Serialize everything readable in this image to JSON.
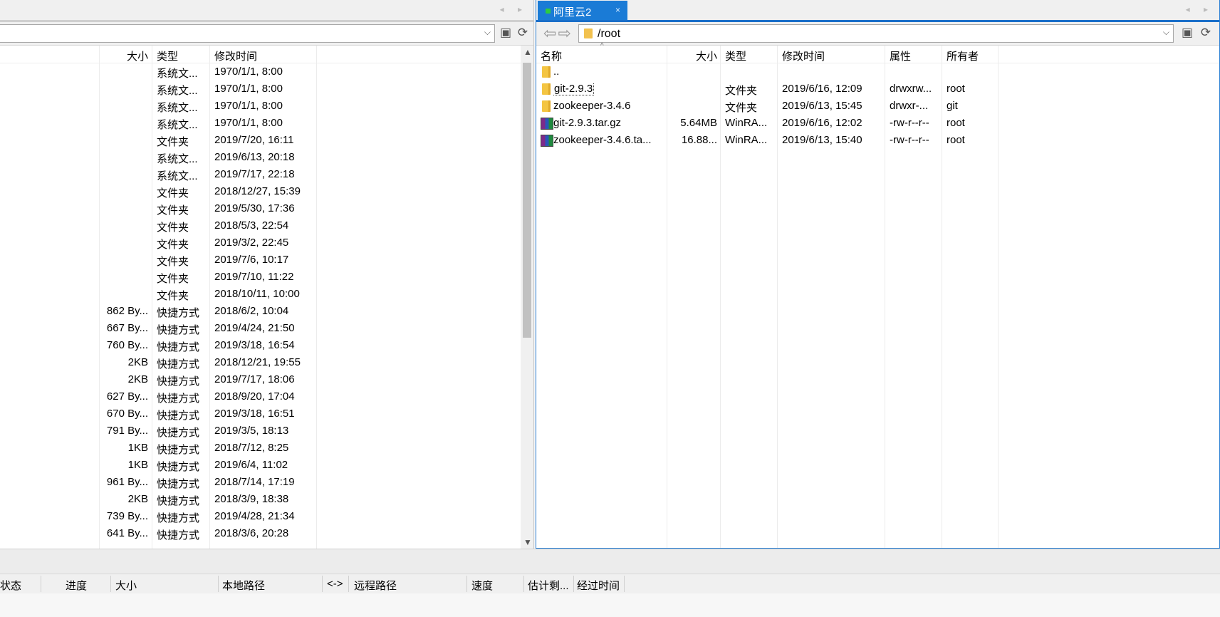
{
  "left": {
    "columns": {
      "size": "大小",
      "type": "类型",
      "mtime": "修改时间"
    },
    "rows": [
      {
        "size": "",
        "type": "系统文...",
        "mtime": "1970/1/1, 8:00"
      },
      {
        "size": "",
        "type": "系统文...",
        "mtime": "1970/1/1, 8:00"
      },
      {
        "size": "",
        "type": "系统文...",
        "mtime": "1970/1/1, 8:00"
      },
      {
        "size": "",
        "type": "系统文...",
        "mtime": "1970/1/1, 8:00"
      },
      {
        "size": "",
        "type": "文件夹",
        "mtime": "2019/7/20, 16:11"
      },
      {
        "size": "",
        "type": "系统文...",
        "mtime": "2019/6/13, 20:18"
      },
      {
        "size": "",
        "type": "系统文...",
        "mtime": "2019/7/17, 22:18"
      },
      {
        "size": "",
        "type": "文件夹",
        "mtime": "2018/12/27, 15:39"
      },
      {
        "size": "",
        "type": "文件夹",
        "mtime": "2019/5/30, 17:36"
      },
      {
        "size": "",
        "type": "文件夹",
        "mtime": "2018/5/3, 22:54"
      },
      {
        "size": "",
        "type": "文件夹",
        "mtime": "2019/3/2, 22:45"
      },
      {
        "size": "",
        "type": "文件夹",
        "mtime": "2019/7/6, 10:17"
      },
      {
        "size": "",
        "type": "文件夹",
        "mtime": "2019/7/10, 11:22"
      },
      {
        "size": "",
        "type": "文件夹",
        "mtime": "2018/10/11, 10:00"
      },
      {
        "size": "862 By...",
        "type": "快捷方式",
        "mtime": "2018/6/2, 10:04"
      },
      {
        "size": "667 By...",
        "type": "快捷方式",
        "mtime": "2019/4/24, 21:50"
      },
      {
        "size": "760 By...",
        "type": "快捷方式",
        "mtime": "2019/3/18, 16:54"
      },
      {
        "size": "2KB",
        "type": "快捷方式",
        "mtime": "2018/12/21, 19:55"
      },
      {
        "size": "2KB",
        "type": "快捷方式",
        "mtime": "2019/7/17, 18:06"
      },
      {
        "size": "627 By...",
        "type": "快捷方式",
        "mtime": "2018/9/20, 17:04"
      },
      {
        "size": "670 By...",
        "type": "快捷方式",
        "mtime": "2019/3/18, 16:51"
      },
      {
        "size": "791 By...",
        "type": "快捷方式",
        "mtime": "2019/3/5, 18:13"
      },
      {
        "size": "1KB",
        "type": "快捷方式",
        "mtime": "2018/7/12, 8:25"
      },
      {
        "size": "1KB",
        "type": "快捷方式",
        "mtime": "2019/6/4, 11:02"
      },
      {
        "size": "961 By...",
        "type": "快捷方式",
        "mtime": "2018/7/14, 17:19"
      },
      {
        "size": "2KB",
        "type": "快捷方式",
        "mtime": "2018/3/9, 18:38"
      },
      {
        "size": "739 By...",
        "type": "快捷方式",
        "mtime": "2019/4/28, 21:34"
      },
      {
        "size": "641 By...",
        "type": "快捷方式",
        "mtime": "2018/3/6, 20:28"
      }
    ]
  },
  "right": {
    "tab_label": "阿里云2",
    "tab_close": "×",
    "path": "/root",
    "columns": {
      "name": "名称",
      "size": "大小",
      "type": "类型",
      "mtime": "修改时间",
      "attrs": "属性",
      "owner": "所有者"
    },
    "rows": [
      {
        "icon": "parent",
        "name": "..",
        "size": "",
        "type": "",
        "mtime": "",
        "attrs": "",
        "owner": ""
      },
      {
        "icon": "folder",
        "name": "git-2.9.3",
        "size": "",
        "type": "文件夹",
        "mtime": "2019/6/16, 12:09",
        "attrs": "drwxrw...",
        "owner": "root"
      },
      {
        "icon": "folder",
        "name": "zookeeper-3.4.6",
        "size": "",
        "type": "文件夹",
        "mtime": "2019/6/13, 15:45",
        "attrs": "drwxr-...",
        "owner": "git"
      },
      {
        "icon": "archive",
        "name": "git-2.9.3.tar.gz",
        "size": "5.64MB",
        "type": "WinRA...",
        "mtime": "2019/6/16, 12:02",
        "attrs": "-rw-r--r--",
        "owner": "root"
      },
      {
        "icon": "archive",
        "name": "zookeeper-3.4.6.ta...",
        "size": "16.88...",
        "type": "WinRA...",
        "mtime": "2019/6/13, 15:40",
        "attrs": "-rw-r--r--",
        "owner": "root"
      }
    ]
  },
  "queue": {
    "columns": [
      "状态",
      "进度",
      "大小",
      "本地路径",
      "<->",
      "远程路径",
      "速度",
      "估计剩...",
      "经过时间"
    ]
  },
  "colors": {
    "accent": "#1a7bd6",
    "connected": "#2ecc40"
  }
}
